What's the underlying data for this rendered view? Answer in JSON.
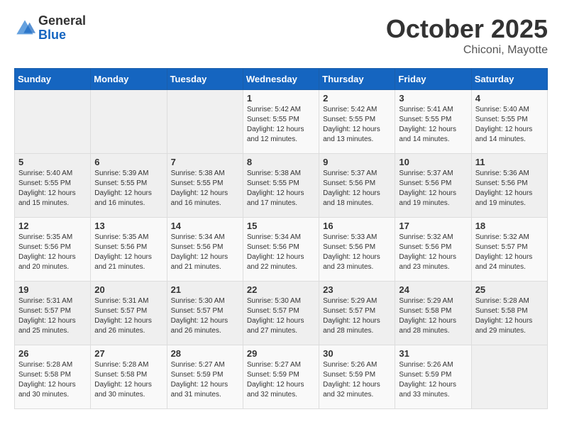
{
  "header": {
    "logo_general": "General",
    "logo_blue": "Blue",
    "month": "October 2025",
    "location": "Chiconi, Mayotte"
  },
  "weekdays": [
    "Sunday",
    "Monday",
    "Tuesday",
    "Wednesday",
    "Thursday",
    "Friday",
    "Saturday"
  ],
  "weeks": [
    [
      {
        "day": "",
        "info": ""
      },
      {
        "day": "",
        "info": ""
      },
      {
        "day": "",
        "info": ""
      },
      {
        "day": "1",
        "info": "Sunrise: 5:42 AM\nSunset: 5:55 PM\nDaylight: 12 hours\nand 12 minutes."
      },
      {
        "day": "2",
        "info": "Sunrise: 5:42 AM\nSunset: 5:55 PM\nDaylight: 12 hours\nand 13 minutes."
      },
      {
        "day": "3",
        "info": "Sunrise: 5:41 AM\nSunset: 5:55 PM\nDaylight: 12 hours\nand 14 minutes."
      },
      {
        "day": "4",
        "info": "Sunrise: 5:40 AM\nSunset: 5:55 PM\nDaylight: 12 hours\nand 14 minutes."
      }
    ],
    [
      {
        "day": "5",
        "info": "Sunrise: 5:40 AM\nSunset: 5:55 PM\nDaylight: 12 hours\nand 15 minutes."
      },
      {
        "day": "6",
        "info": "Sunrise: 5:39 AM\nSunset: 5:55 PM\nDaylight: 12 hours\nand 16 minutes."
      },
      {
        "day": "7",
        "info": "Sunrise: 5:38 AM\nSunset: 5:55 PM\nDaylight: 12 hours\nand 16 minutes."
      },
      {
        "day": "8",
        "info": "Sunrise: 5:38 AM\nSunset: 5:55 PM\nDaylight: 12 hours\nand 17 minutes."
      },
      {
        "day": "9",
        "info": "Sunrise: 5:37 AM\nSunset: 5:56 PM\nDaylight: 12 hours\nand 18 minutes."
      },
      {
        "day": "10",
        "info": "Sunrise: 5:37 AM\nSunset: 5:56 PM\nDaylight: 12 hours\nand 19 minutes."
      },
      {
        "day": "11",
        "info": "Sunrise: 5:36 AM\nSunset: 5:56 PM\nDaylight: 12 hours\nand 19 minutes."
      }
    ],
    [
      {
        "day": "12",
        "info": "Sunrise: 5:35 AM\nSunset: 5:56 PM\nDaylight: 12 hours\nand 20 minutes."
      },
      {
        "day": "13",
        "info": "Sunrise: 5:35 AM\nSunset: 5:56 PM\nDaylight: 12 hours\nand 21 minutes."
      },
      {
        "day": "14",
        "info": "Sunrise: 5:34 AM\nSunset: 5:56 PM\nDaylight: 12 hours\nand 21 minutes."
      },
      {
        "day": "15",
        "info": "Sunrise: 5:34 AM\nSunset: 5:56 PM\nDaylight: 12 hours\nand 22 minutes."
      },
      {
        "day": "16",
        "info": "Sunrise: 5:33 AM\nSunset: 5:56 PM\nDaylight: 12 hours\nand 23 minutes."
      },
      {
        "day": "17",
        "info": "Sunrise: 5:32 AM\nSunset: 5:56 PM\nDaylight: 12 hours\nand 23 minutes."
      },
      {
        "day": "18",
        "info": "Sunrise: 5:32 AM\nSunset: 5:57 PM\nDaylight: 12 hours\nand 24 minutes."
      }
    ],
    [
      {
        "day": "19",
        "info": "Sunrise: 5:31 AM\nSunset: 5:57 PM\nDaylight: 12 hours\nand 25 minutes."
      },
      {
        "day": "20",
        "info": "Sunrise: 5:31 AM\nSunset: 5:57 PM\nDaylight: 12 hours\nand 26 minutes."
      },
      {
        "day": "21",
        "info": "Sunrise: 5:30 AM\nSunset: 5:57 PM\nDaylight: 12 hours\nand 26 minutes."
      },
      {
        "day": "22",
        "info": "Sunrise: 5:30 AM\nSunset: 5:57 PM\nDaylight: 12 hours\nand 27 minutes."
      },
      {
        "day": "23",
        "info": "Sunrise: 5:29 AM\nSunset: 5:57 PM\nDaylight: 12 hours\nand 28 minutes."
      },
      {
        "day": "24",
        "info": "Sunrise: 5:29 AM\nSunset: 5:58 PM\nDaylight: 12 hours\nand 28 minutes."
      },
      {
        "day": "25",
        "info": "Sunrise: 5:28 AM\nSunset: 5:58 PM\nDaylight: 12 hours\nand 29 minutes."
      }
    ],
    [
      {
        "day": "26",
        "info": "Sunrise: 5:28 AM\nSunset: 5:58 PM\nDaylight: 12 hours\nand 30 minutes."
      },
      {
        "day": "27",
        "info": "Sunrise: 5:28 AM\nSunset: 5:58 PM\nDaylight: 12 hours\nand 30 minutes."
      },
      {
        "day": "28",
        "info": "Sunrise: 5:27 AM\nSunset: 5:59 PM\nDaylight: 12 hours\nand 31 minutes."
      },
      {
        "day": "29",
        "info": "Sunrise: 5:27 AM\nSunset: 5:59 PM\nDaylight: 12 hours\nand 32 minutes."
      },
      {
        "day": "30",
        "info": "Sunrise: 5:26 AM\nSunset: 5:59 PM\nDaylight: 12 hours\nand 32 minutes."
      },
      {
        "day": "31",
        "info": "Sunrise: 5:26 AM\nSunset: 5:59 PM\nDaylight: 12 hours\nand 33 minutes."
      },
      {
        "day": "",
        "info": ""
      }
    ]
  ]
}
